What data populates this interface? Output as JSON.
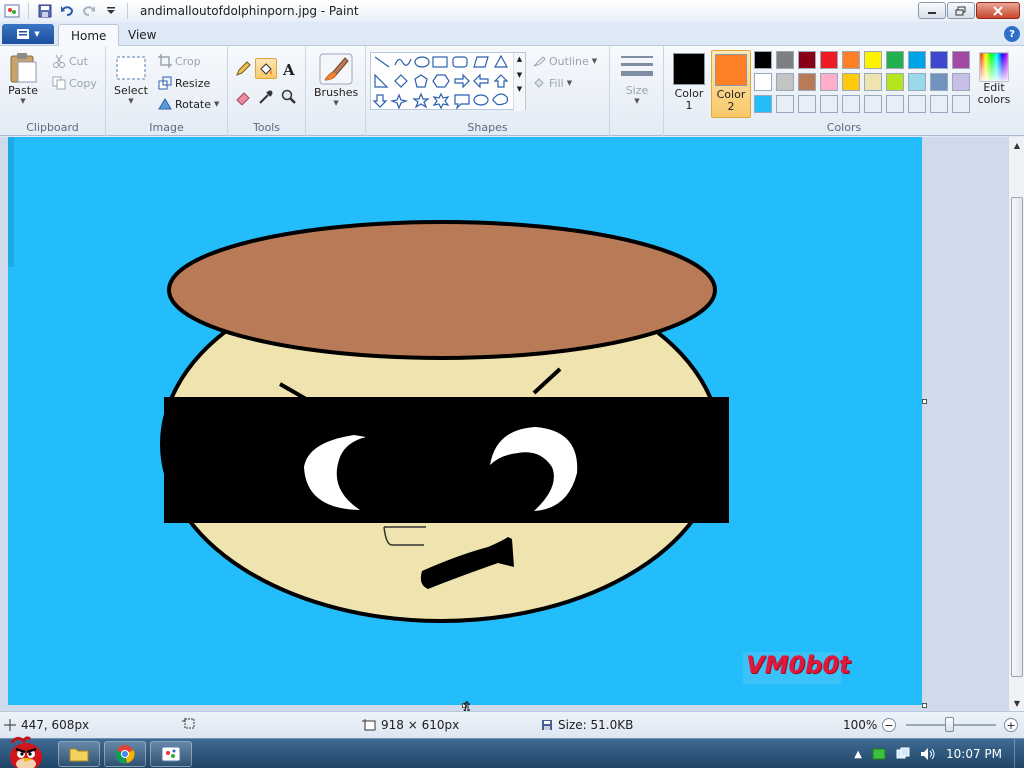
{
  "window": {
    "title": "andimalloutofdolphinporn.jpg - Paint"
  },
  "tabs": [
    {
      "label": "Home"
    },
    {
      "label": "View"
    }
  ],
  "ribbon": {
    "clipboard": {
      "label": "Clipboard",
      "paste": "Paste",
      "cut": "Cut",
      "copy": "Copy"
    },
    "image": {
      "label": "Image",
      "select": "Select",
      "crop": "Crop",
      "resize": "Resize",
      "rotate": "Rotate"
    },
    "tools": {
      "label": "Tools"
    },
    "brushes": {
      "label": "Brushes"
    },
    "shapes": {
      "label": "Shapes",
      "outline": "Outline",
      "fill": "Fill"
    },
    "size": {
      "label": "Size"
    },
    "colors": {
      "label": "Colors",
      "color1": "Color\n1",
      "color1_a": "Color",
      "color1_b": "1",
      "color2_a": "Color",
      "color2_b": "2",
      "color1_value": "#000000",
      "color2_value": "#ff7f27",
      "edit_a": "Edit",
      "edit_b": "colors",
      "palette_row1": [
        "#000000",
        "#7f7f7f",
        "#880015",
        "#ed1c24",
        "#ff7f27",
        "#fff200",
        "#22b14c",
        "#00a2e8",
        "#3f48cc",
        "#a349a4"
      ],
      "palette_row2": [
        "#ffffff",
        "#c3c3c3",
        "#b97a57",
        "#ffaec9",
        "#ffc90e",
        "#efe4b0",
        "#b5e61d",
        "#99d9ea",
        "#7092be",
        "#c8bfe7"
      ],
      "palette_row3": [
        "#22bdfa",
        "#e8eef5",
        "#e8eef5",
        "#e8eef5",
        "#e8eef5",
        "#e8eef5",
        "#e8eef5",
        "#e8eef5",
        "#e8eef5",
        "#e8eef5"
      ]
    }
  },
  "canvas": {
    "background": "#22bdfa",
    "watermark": "VM0b0t",
    "hat_color": "#b97a57",
    "face_color": "#efe4b0"
  },
  "status": {
    "cursor_pos": "447, 608px",
    "dimensions": "918 × 610px",
    "size": "Size: 51.0KB",
    "zoom": "100%"
  },
  "taskbar": {
    "clock": "10:07 PM"
  }
}
